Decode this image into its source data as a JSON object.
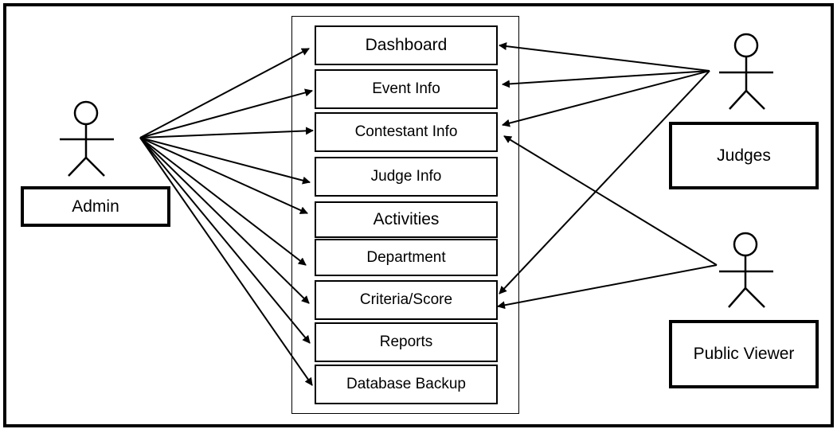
{
  "diagram": {
    "type": "use-case",
    "system_use_cases": [
      {
        "id": "dashboard",
        "label": "Dashboard"
      },
      {
        "id": "event-info",
        "label": "Event Info"
      },
      {
        "id": "contestant-info",
        "label": "Contestant Info"
      },
      {
        "id": "judge-info",
        "label": "Judge Info"
      },
      {
        "id": "activities",
        "label": "Activities"
      },
      {
        "id": "department",
        "label": "Department"
      },
      {
        "id": "criteria-score",
        "label": "Criteria/Score"
      },
      {
        "id": "reports",
        "label": "Reports"
      },
      {
        "id": "database-backup",
        "label": "Database Backup"
      }
    ],
    "actors": [
      {
        "id": "admin",
        "label": "Admin"
      },
      {
        "id": "judges",
        "label": "Judges"
      },
      {
        "id": "public-viewer",
        "label": "Public Viewer"
      }
    ],
    "associations": [
      {
        "from": "admin",
        "to": "dashboard"
      },
      {
        "from": "admin",
        "to": "event-info"
      },
      {
        "from": "admin",
        "to": "contestant-info"
      },
      {
        "from": "admin",
        "to": "judge-info"
      },
      {
        "from": "admin",
        "to": "activities"
      },
      {
        "from": "admin",
        "to": "department"
      },
      {
        "from": "admin",
        "to": "criteria-score"
      },
      {
        "from": "admin",
        "to": "reports"
      },
      {
        "from": "admin",
        "to": "database-backup"
      },
      {
        "from": "judges",
        "to": "dashboard"
      },
      {
        "from": "judges",
        "to": "event-info"
      },
      {
        "from": "judges",
        "to": "contestant-info"
      },
      {
        "from": "judges",
        "to": "criteria-score"
      },
      {
        "from": "public-viewer",
        "to": "contestant-info"
      },
      {
        "from": "public-viewer",
        "to": "criteria-score"
      }
    ]
  }
}
